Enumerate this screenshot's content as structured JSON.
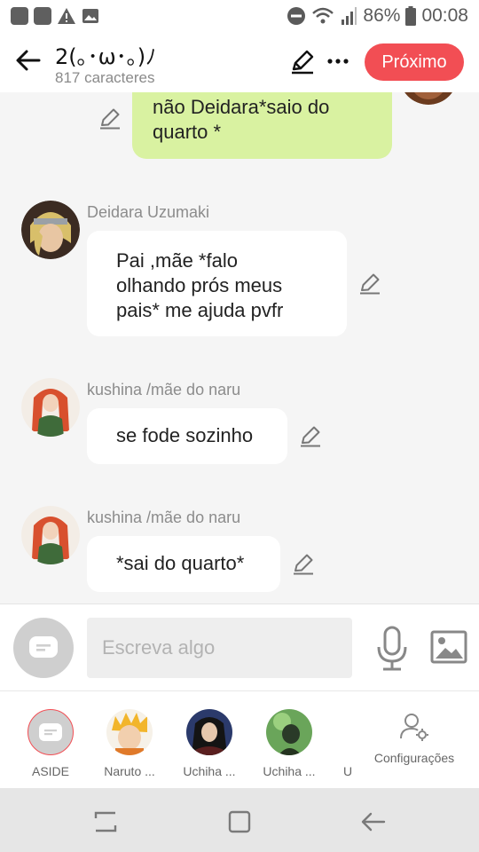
{
  "status_bar": {
    "battery": "86%",
    "time": "00:08"
  },
  "header": {
    "title": "2(｡･ω･｡)ﾉ",
    "subtitle": "817 caracteres",
    "next_label": "Próximo"
  },
  "messages": [
    {
      "type": "mine",
      "text": "não Deidara*saio do\nquarto *"
    },
    {
      "type": "other",
      "sender": "Deidara Uzumaki",
      "text": "Pai ,mãe *falo\nolhando prós meus\npais* me ajuda pvfr"
    },
    {
      "type": "other",
      "sender": "kushina /mãe do naru",
      "text": "se fode sozinho"
    },
    {
      "type": "other",
      "sender": "kushina /mãe do naru",
      "text": "*sai do quarto*"
    }
  ],
  "composer": {
    "placeholder": "Escreva algo"
  },
  "characters": [
    {
      "label": "ASIDE"
    },
    {
      "label": "Naruto ..."
    },
    {
      "label": "Uchiha ..."
    },
    {
      "label": "Uchiha ..."
    },
    {
      "label": "U"
    },
    {
      "label": "Configurações"
    }
  ],
  "colors": {
    "accent": "#f24e54",
    "my_bubble": "#d9f2a1"
  }
}
